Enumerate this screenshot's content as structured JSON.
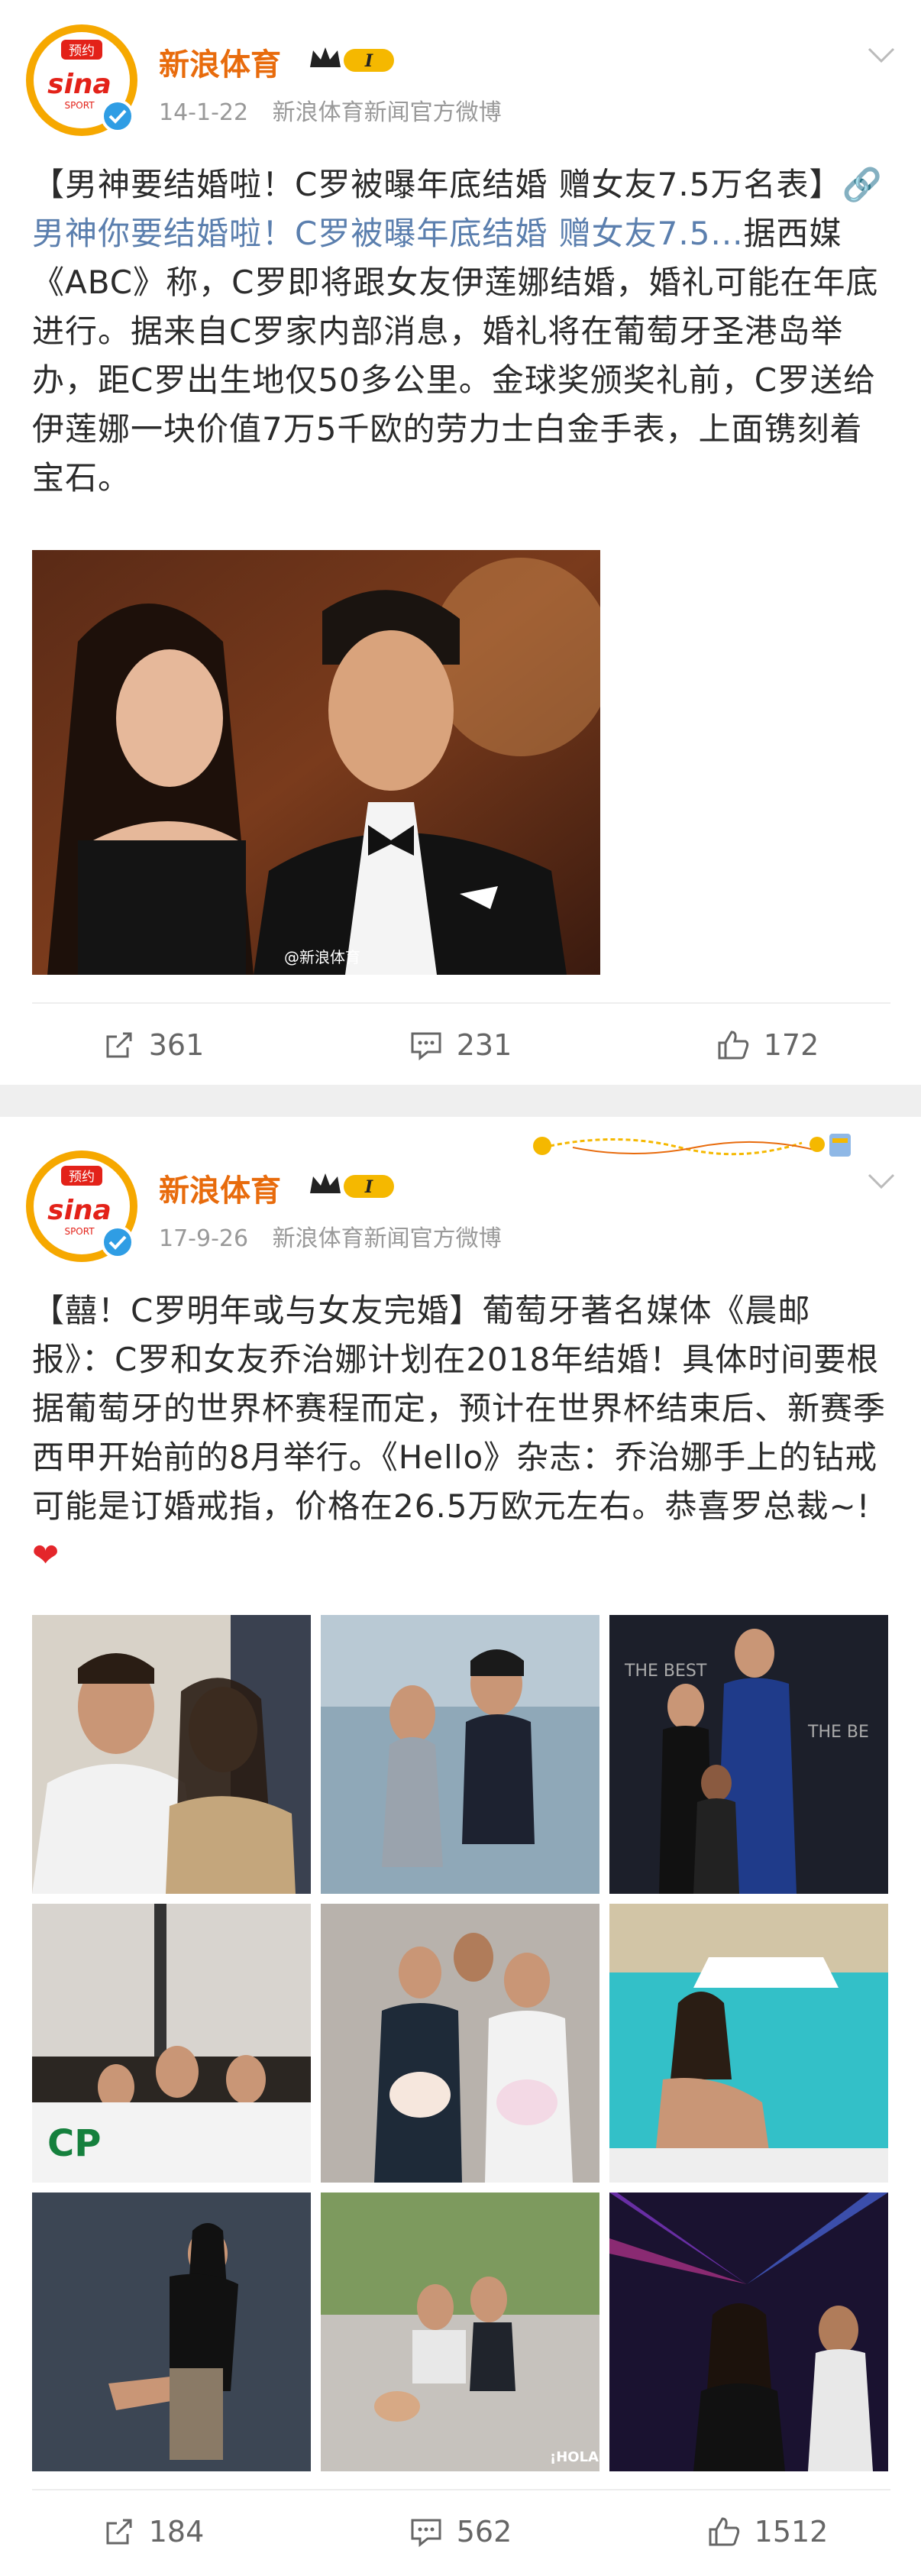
{
  "posts": [
    {
      "user": {
        "name": "新浪体育",
        "avatar_badge_top": "预约",
        "avatar_logo": "sina",
        "avatar_logo_sub": "SPORT",
        "vip_level": "I"
      },
      "date": "14-1-22",
      "source": "新浪体育新闻官方微博",
      "text": {
        "title": "【男神要结婚啦！C罗被曝年底结婚 赠女友7.5万名表】",
        "link": "男神你要结婚啦！C罗被曝年底结婚 赠女友7.5...",
        "body": "据西媒《ABC》称，C罗即将跟女友伊莲娜结婚，婚礼可能在年底进行。据来自C罗家内部消息，婚礼将在葡萄牙圣港岛举办，距C罗出生地仅50多公里。金球奖颁奖礼前，C罗送给伊莲娜一块价值7万5千欧的劳力士白金手表，上面镌刻着宝石。"
      },
      "image_watermark": "@新浪体育",
      "actions": {
        "repost": "361",
        "comment": "231",
        "like": "172"
      }
    },
    {
      "user": {
        "name": "新浪体育",
        "avatar_badge_top": "预约",
        "avatar_logo": "sina",
        "avatar_logo_sub": "SPORT",
        "vip_level": "I"
      },
      "date": "17-9-26",
      "source": "新浪体育新闻官方微博",
      "text": {
        "body": "【囍！C罗明年或与女友完婚】葡萄牙著名媒体《晨邮报》：C罗和女友乔治娜计划在2018年结婚！具体时间要根据葡萄牙的世界杯赛程而定，预计在世界杯结束后、新赛季西甲开始前的8月举行。《Hello》杂志：乔治娜手上的钻戒可能是订婚戒指，价格在26.5万欧元左右。恭喜罗总裁~!",
        "emoji": "❤"
      },
      "grid_captions": [
        "",
        "",
        "THE BEST",
        "",
        "",
        "",
        "",
        "",
        ""
      ],
      "grid_watermark_cp": "CP",
      "grid_watermark_hola": "¡HOLA!",
      "actions": {
        "repost": "184",
        "comment": "562",
        "like": "1512"
      }
    }
  ],
  "colors": {
    "username": "#e86b0c",
    "link": "#5b7fae",
    "meta": "#999999",
    "heart": "#e4262b",
    "vip_gold": "#f5b800"
  },
  "icons": [
    "chevron-down-icon",
    "verified-icon",
    "repost-icon",
    "comment-icon",
    "like-icon",
    "crown-icon"
  ]
}
